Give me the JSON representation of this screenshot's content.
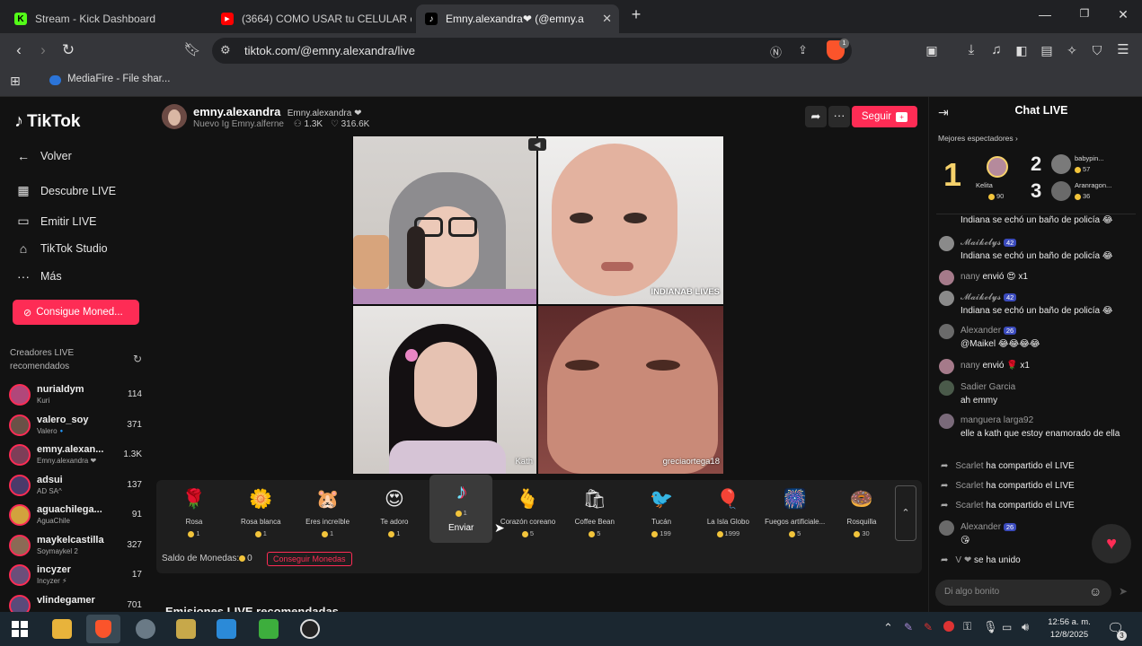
{
  "browser": {
    "tabs": [
      {
        "title": "Stream - Kick Dashboard",
        "fav": "K",
        "fav_color": "#53fc18"
      },
      {
        "title": "(3664) COMO USAR tu CELULAR com",
        "fav": "▶",
        "fav_color": "#ff0000"
      },
      {
        "title": "Emny.alexandra❤ (@emny.a",
        "fav": "♪",
        "fav_color": "#000000"
      }
    ],
    "new_tab": "+",
    "url": "tiktok.com/@emny.alexandra/live",
    "bookmark": "MediaFire - File shar...",
    "shield_badge": "1"
  },
  "tiktok": {
    "logo": "TikTok",
    "nav": [
      {
        "label": "Volver",
        "icon": "←"
      },
      {
        "label": "Descubre LIVE",
        "icon": "▦"
      },
      {
        "label": "Emitir LIVE",
        "icon": "▭"
      },
      {
        "label": "TikTok Studio",
        "icon": "⌂"
      },
      {
        "label": "Más",
        "icon": "···"
      }
    ],
    "coins_button": "Consigue Moned...",
    "creators_heading": "Creadores LIVE recomendados",
    "creators": [
      {
        "name": "nurialdym",
        "sub": "Kuri",
        "count": "114",
        "color": "#b1477a"
      },
      {
        "name": "valero_soy",
        "sub": "Valero🔹",
        "count": "371",
        "color": "#6a5147"
      },
      {
        "name": "emny.alexan...",
        "sub": "Emny.alexandra ❤",
        "count": "1.3K",
        "color": "#7d3e58"
      },
      {
        "name": "adsui",
        "sub": "AD SA^",
        "count": "137",
        "color": "#4a3a6a"
      },
      {
        "name": "aguachilega...",
        "sub": "AguaChile",
        "count": "91",
        "color": "#d2a23d"
      },
      {
        "name": "maykelcastilla",
        "sub": "Soymaykel 2",
        "count": "327",
        "color": "#8b6a55"
      },
      {
        "name": "incyzer",
        "sub": "Incyzer ⚡",
        "count": "17",
        "color": "#6b4e7a"
      },
      {
        "name": "vlindegamer",
        "sub": "",
        "count": "701",
        "color": "#5a4a7a"
      }
    ]
  },
  "stream": {
    "username": "emny.alexandra",
    "display": "Emny.alexandra ❤",
    "bio": "Nuevo Ig Emny.alferne",
    "viewers": "1.3K",
    "likes": "316.6K",
    "follow": "Seguir",
    "tile_labels": [
      "",
      "INDIANAB LIVES",
      "Kath",
      "greciaortega18"
    ]
  },
  "gifts": {
    "items": [
      {
        "name": "Rosa",
        "price": "1",
        "icon": "🌹"
      },
      {
        "name": "Rosa blanca",
        "price": "1",
        "icon": "🌼"
      },
      {
        "name": "Eres increíble",
        "price": "1",
        "icon": "🐹"
      },
      {
        "name": "Te adoro",
        "price": "1",
        "icon": "😍"
      },
      {
        "name": "Enviar",
        "price": "1",
        "icon": "♪"
      },
      {
        "name": "Corazón coreano",
        "price": "5",
        "icon": "🫰"
      },
      {
        "name": "Coffee Bean",
        "price": "5",
        "icon": "🛍"
      },
      {
        "name": "Tucán",
        "price": "199",
        "icon": "🐦"
      },
      {
        "name": "La Isla Globo",
        "price": "1999",
        "icon": "🎈"
      },
      {
        "name": "Fuegos artificiale...",
        "price": "5",
        "icon": "🎆"
      },
      {
        "name": "Rosquilla",
        "price": "30",
        "icon": "🍩"
      }
    ],
    "balance_label": "Saldo de Monedas:",
    "balance": "0",
    "get_coins": "Conseguir Monedas"
  },
  "below_section": "Emisiones LIVE recomendadas",
  "chat": {
    "title": "Chat LIVE",
    "top_heading": "Mejores espectadores",
    "top": [
      {
        "rank": "1",
        "name": "Kelita",
        "score": "90"
      },
      {
        "rank": "2",
        "name": "babypin...",
        "score": "57"
      },
      {
        "rank": "3",
        "name": "Aranragon...",
        "score": "36"
      }
    ],
    "messages": [
      {
        "user": "",
        "text": "Indiana se echó un baño de policía 😂"
      },
      {
        "user": "𝓜𝓪𝓲𝓴𝓮𝓵𝔂𝓼",
        "badge": "42",
        "text": "Indiana se echó un baño de policía 😂"
      },
      {
        "user": "nany",
        "text": "envió 😍 x1",
        "inline": true
      },
      {
        "user": "𝓜𝓪𝓲𝓴𝓮𝓵𝔂𝓼",
        "badge": "42",
        "text": "Indiana se echó un baño de policía 😂"
      },
      {
        "user": "Alexander",
        "badge": "26",
        "text": "@Maikel 😂😂😂😂"
      },
      {
        "user": "nany",
        "text": "envió 🌹 x1",
        "inline": true
      },
      {
        "user": "Sadier Garcia",
        "text": "ah emmy"
      },
      {
        "user": "manguera larga92",
        "text": "elle a kath que estoy enamorado de ella"
      },
      {
        "user": "Scarlet",
        "text": "ha compartido el LIVE",
        "share": true
      },
      {
        "user": "Scarlet",
        "text": "ha compartido el LIVE",
        "share": true
      },
      {
        "user": "Scarlet",
        "text": "ha compartido el LIVE",
        "share": true
      },
      {
        "user": "Alexander",
        "badge": "26",
        "text": "😘"
      },
      {
        "user": "V ❤",
        "text": "se ha unido",
        "share": true
      }
    ],
    "input_placeholder": "Di algo bonito"
  },
  "taskbar": {
    "time": "12:56 a. m.",
    "date": "12/8/2025",
    "notif": "3"
  }
}
